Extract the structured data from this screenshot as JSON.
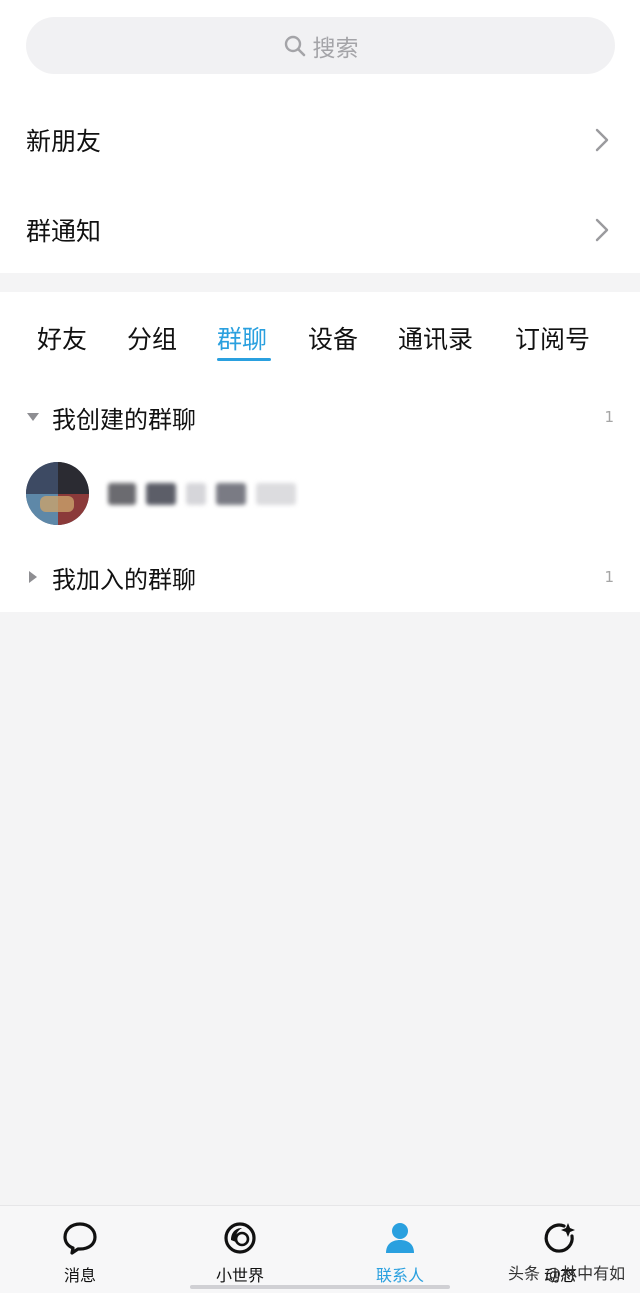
{
  "search": {
    "placeholder": "搜索",
    "icon": "search-icon"
  },
  "menu": {
    "new_friends": "新朋友",
    "group_notice": "群通知"
  },
  "tabs": [
    {
      "label": "好友",
      "active": false
    },
    {
      "label": "分组",
      "active": false
    },
    {
      "label": "群聊",
      "active": true
    },
    {
      "label": "设备",
      "active": false
    },
    {
      "label": "通讯录",
      "active": false
    },
    {
      "label": "订阅号",
      "active": false
    }
  ],
  "groups": {
    "created": {
      "label": "我创建的群聊",
      "count": "1",
      "expanded": true
    },
    "joined": {
      "label": "我加入的群聊",
      "count": "1",
      "expanded": false
    }
  },
  "bottom_nav": [
    {
      "label": "消息",
      "icon": "chat-bubble-icon",
      "active": false
    },
    {
      "label": "小世界",
      "icon": "small-world-icon",
      "active": false
    },
    {
      "label": "联系人",
      "icon": "contacts-person-icon",
      "active": true
    },
    {
      "label": "动态",
      "icon": "refresh-star-icon",
      "active": false
    }
  ],
  "watermark": "头条 @林中有如",
  "colors": {
    "accent": "#2aa0df",
    "background": "#f4f4f5",
    "text": "#111111"
  }
}
